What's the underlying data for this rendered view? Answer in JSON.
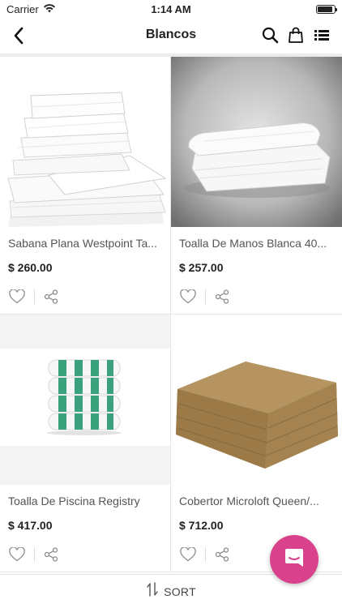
{
  "status_bar": {
    "carrier": "Carrier",
    "time": "1:14 AM",
    "battery_level": 0.9
  },
  "nav": {
    "title": "Blancos",
    "icons": [
      "back-chevron-icon",
      "search-icon",
      "shopping-bag-icon",
      "list-view-icon"
    ]
  },
  "products": [
    {
      "name": "Sabana Plana Westpoint Ta...",
      "price": "$ 260.00",
      "image": "folded-white-sheets"
    },
    {
      "name": "Toalla De Manos Blanca 40...",
      "price": "$ 257.00",
      "image": "folded-white-towel"
    },
    {
      "name": "Toalla De Piscina Registry",
      "price": "$ 417.00",
      "image": "green-striped-pool-towels"
    },
    {
      "name": "Cobertor Microloft Queen/...",
      "price": "$ 712.00",
      "image": "folded-tan-blanket"
    }
  ],
  "sort": {
    "label": "SORT",
    "icon": "sort-arrows-icon"
  },
  "chat": {
    "icon": "chat-bubble-icon",
    "color": "#d9418c"
  },
  "colors": {
    "accent": "#d9418c",
    "divider": "#e6e6e6"
  }
}
